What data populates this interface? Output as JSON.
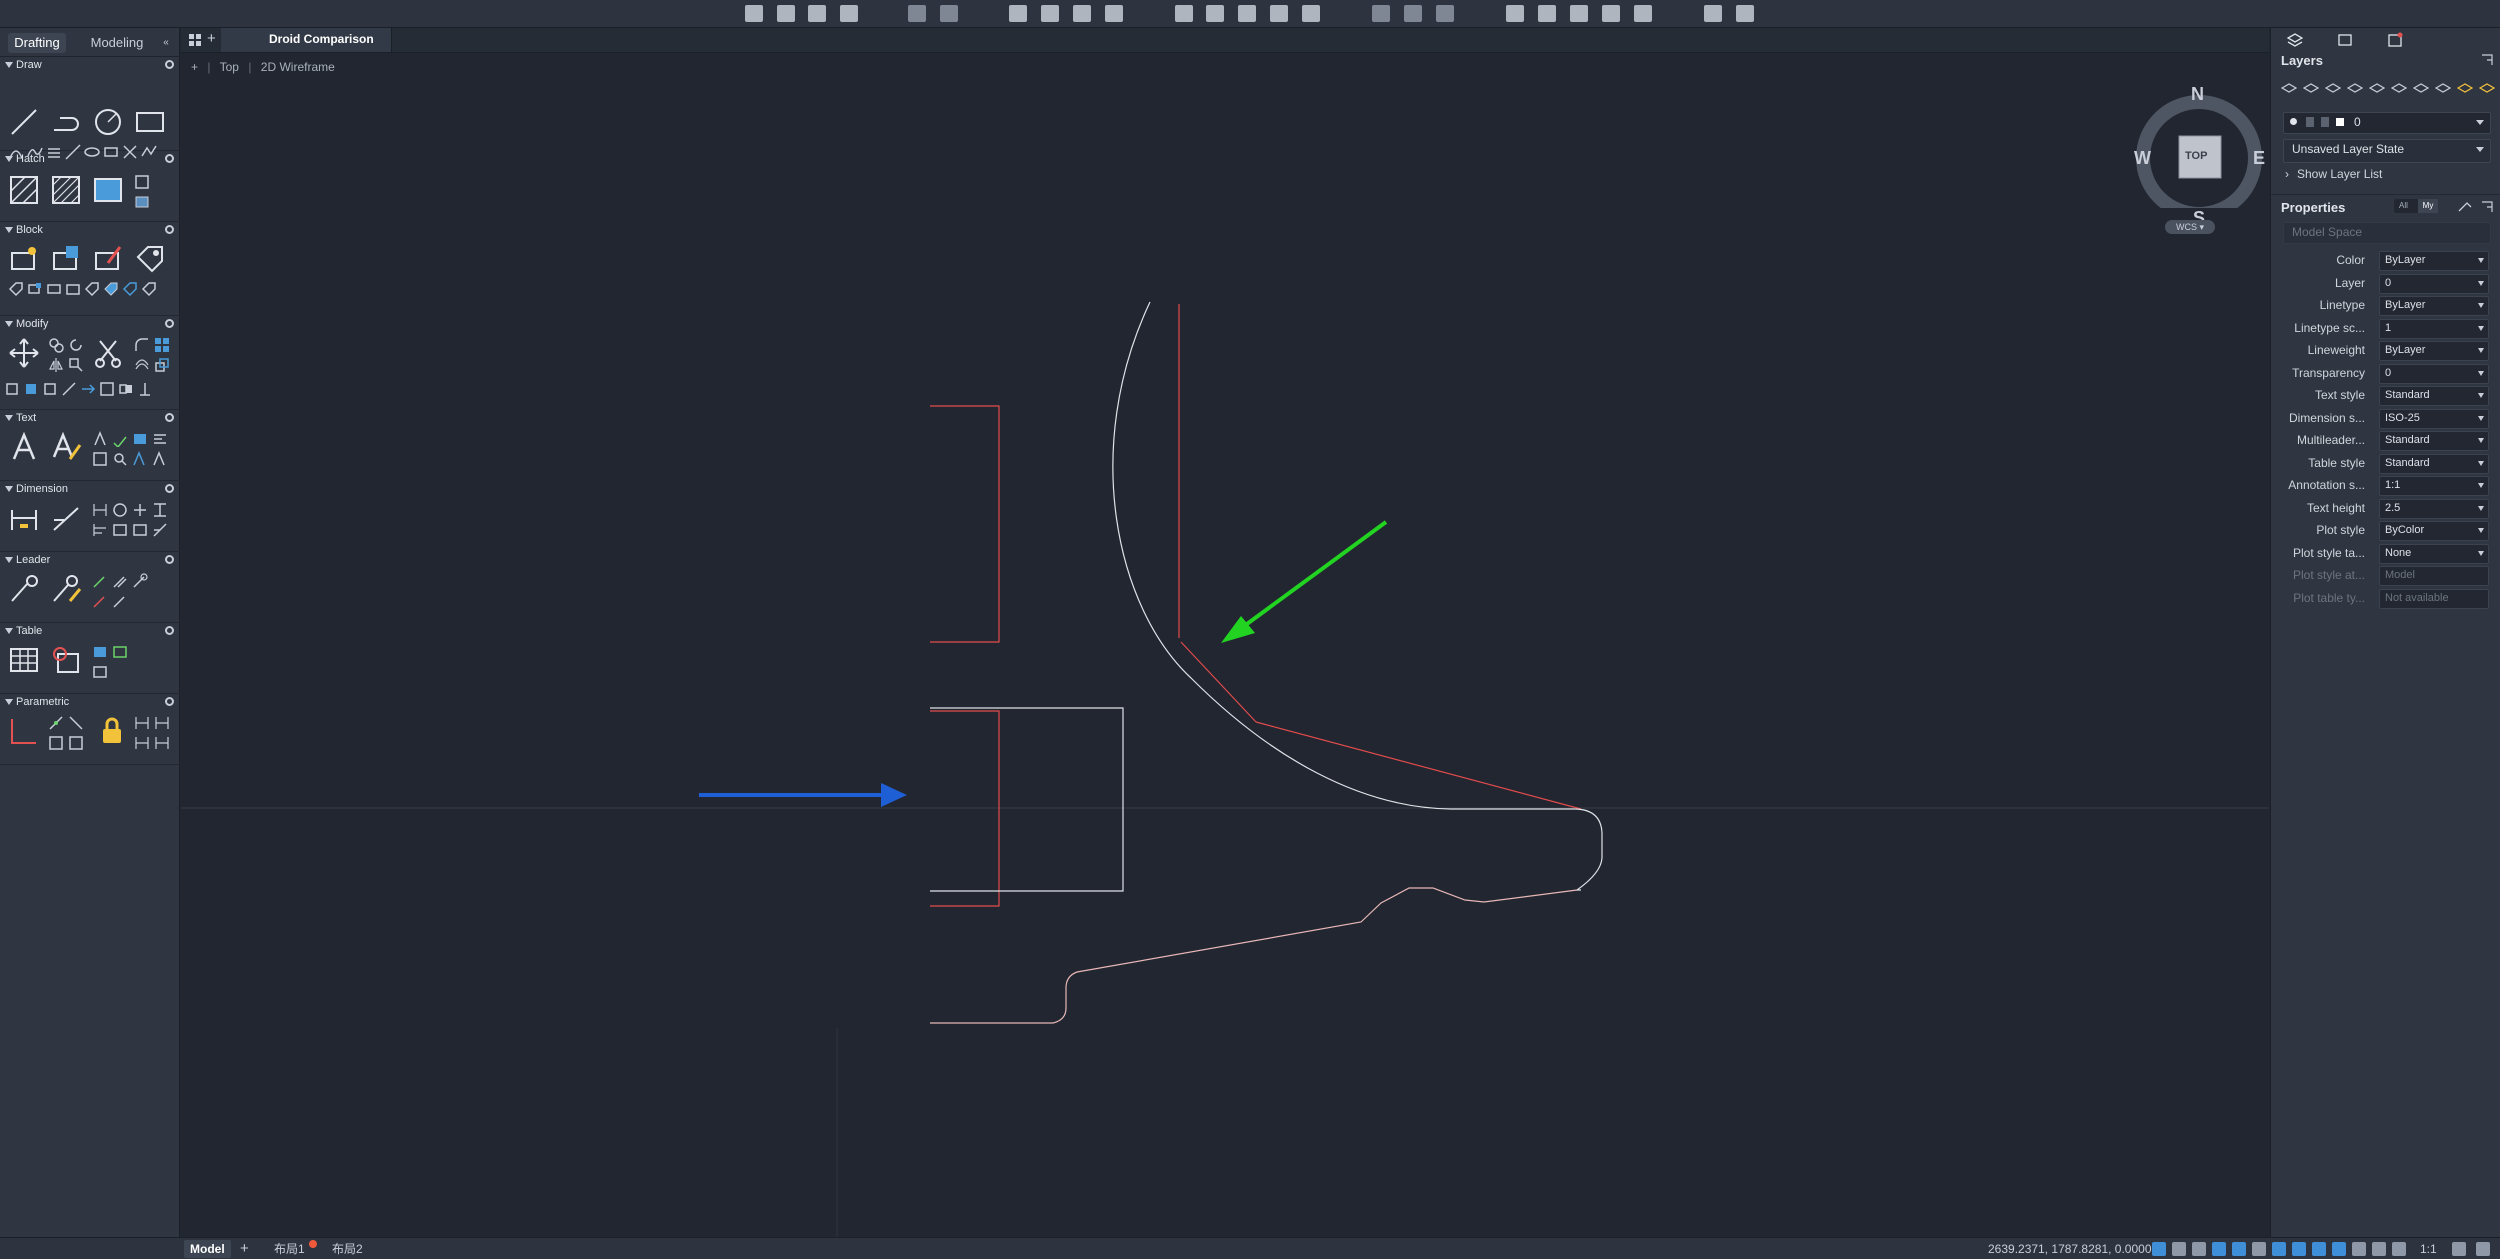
{
  "workspace_tabs": [
    {
      "label": "Drafting",
      "active": true
    },
    {
      "label": "Modeling",
      "active": false
    }
  ],
  "palette_sections": [
    {
      "name": "Draw"
    },
    {
      "name": "Hatch"
    },
    {
      "name": "Block"
    },
    {
      "name": "Modify"
    },
    {
      "name": "Text"
    },
    {
      "name": "Dimension"
    },
    {
      "name": "Leader"
    },
    {
      "name": "Table"
    },
    {
      "name": "Parametric"
    }
  ],
  "document": {
    "title": "Droid Comparison",
    "view_name": "Top",
    "visual_style": "2D Wireframe",
    "add_tab_symbol": "+",
    "viewport_control": "+"
  },
  "viewcube": {
    "face": "TOP",
    "north": "N",
    "south": "S",
    "east": "E",
    "west": "W",
    "ucs_label": "WCS"
  },
  "layers": {
    "title": "Layers",
    "current_layer": "0",
    "layer_state": "Unsaved Layer State",
    "show_layer_list": "Show Layer List"
  },
  "properties": {
    "title": "Properties",
    "filter_all": "All",
    "filter_my": "My",
    "space": "Model Space",
    "rows": [
      {
        "name": "Color",
        "value": "ByLayer",
        "disabled": false
      },
      {
        "name": "Layer",
        "value": "0",
        "disabled": false
      },
      {
        "name": "Linetype",
        "value": "ByLayer",
        "disabled": false
      },
      {
        "name": "Linetype sc...",
        "value": "1",
        "disabled": false
      },
      {
        "name": "Lineweight",
        "value": "ByLayer",
        "disabled": false
      },
      {
        "name": "Transparency",
        "value": "0",
        "disabled": false
      },
      {
        "name": "Text style",
        "value": "Standard",
        "disabled": false
      },
      {
        "name": "Dimension s...",
        "value": "ISO-25",
        "disabled": false
      },
      {
        "name": "Multileader...",
        "value": "Standard",
        "disabled": false
      },
      {
        "name": "Table style",
        "value": "Standard",
        "disabled": false
      },
      {
        "name": "Annotation s...",
        "value": "1:1",
        "disabled": false
      },
      {
        "name": "Text height",
        "value": "2.5",
        "disabled": false
      },
      {
        "name": "Plot style",
        "value": "ByColor",
        "disabled": false
      },
      {
        "name": "Plot style ta...",
        "value": "None",
        "disabled": false
      },
      {
        "name": "Plot style at...",
        "value": "Model",
        "disabled": true
      },
      {
        "name": "Plot table ty...",
        "value": "Not available",
        "disabled": true
      }
    ]
  },
  "status": {
    "layout_tabs": [
      {
        "label": "Model",
        "active": true
      },
      {
        "label": "布局1",
        "active": false
      },
      {
        "label": "布局2",
        "active": false
      }
    ],
    "coordinates": "2639.2371, 1787.8281, 0.0000",
    "scale": "1:1"
  },
  "colors": {
    "canvas_bg": "#212630",
    "panel_bg": "#2f3642",
    "arrow_green": "#22d322",
    "arrow_blue": "#1f5fd6",
    "line_red": "#e24c4c",
    "line_white": "#dfe2e6"
  }
}
